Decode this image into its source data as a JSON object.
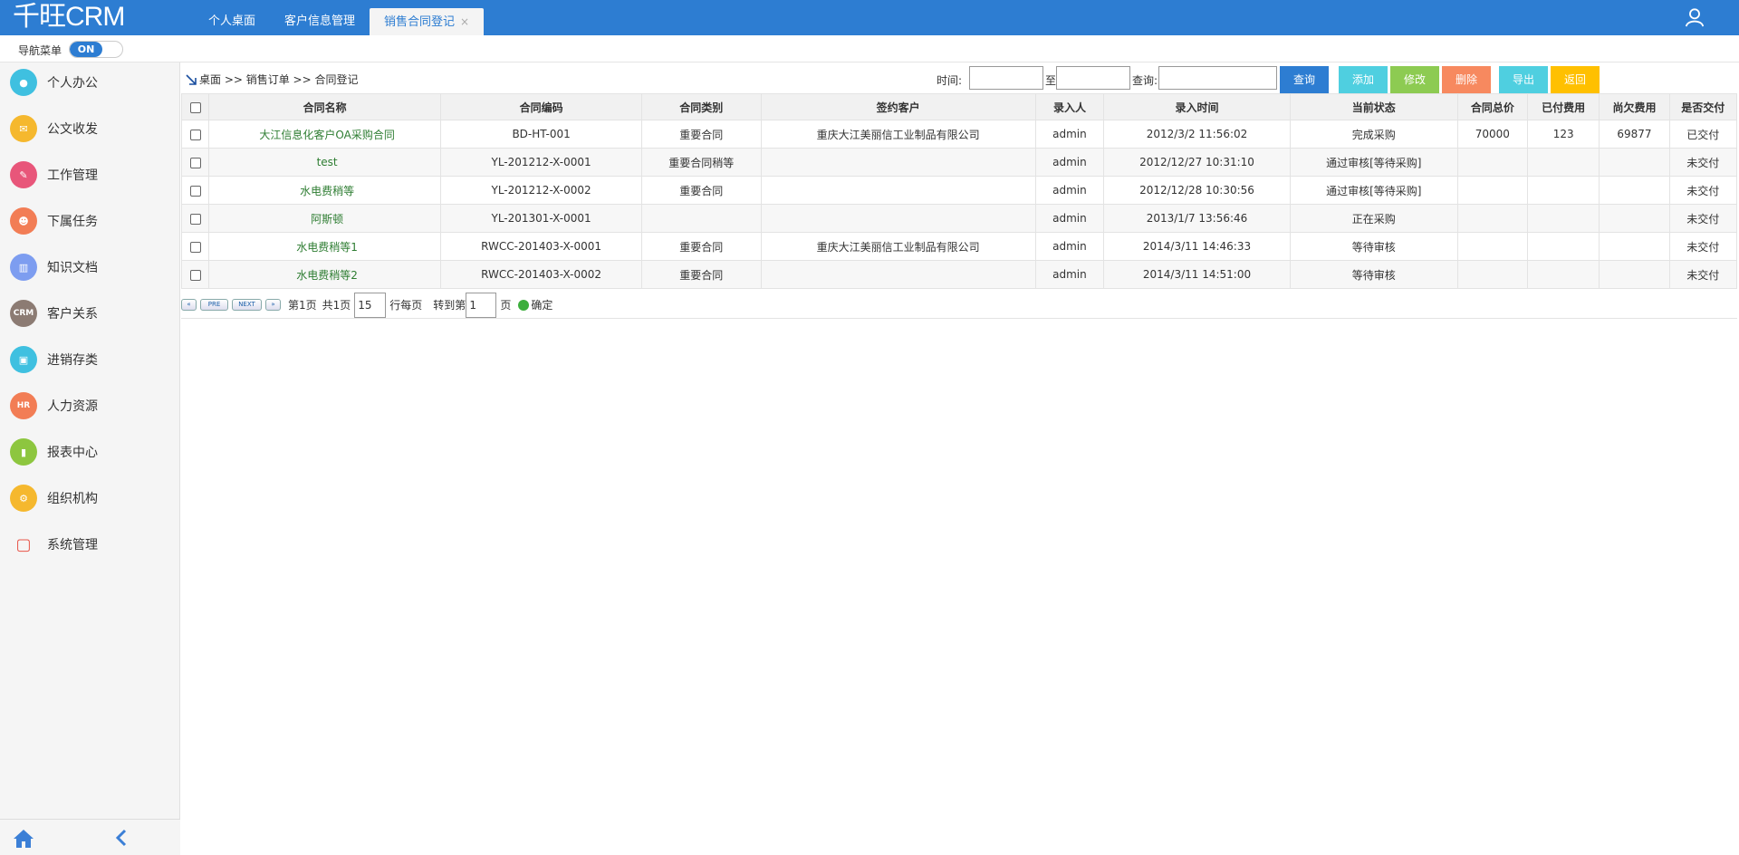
{
  "app": {
    "logo": "千旺CRM"
  },
  "tabs": [
    {
      "label": "个人桌面"
    },
    {
      "label": "客户信息管理"
    },
    {
      "label": "销售合同登记",
      "close": "×"
    }
  ],
  "nav": {
    "label": "导航菜单",
    "toggle": "ON"
  },
  "sidebar": {
    "items": [
      {
        "label": "个人办公",
        "icon": "person-icon",
        "color": "#3fc0e0",
        "glyph": "●"
      },
      {
        "label": "公文收发",
        "icon": "document-icon",
        "color": "#f5b82e",
        "glyph": "✉"
      },
      {
        "label": "工作管理",
        "icon": "work-icon",
        "color": "#e8567a",
        "glyph": "✎"
      },
      {
        "label": "下属任务",
        "icon": "team-icon",
        "color": "#f27d55",
        "glyph": "☻"
      },
      {
        "label": "知识文档",
        "icon": "book-icon",
        "color": "#7d9df0",
        "glyph": "▥"
      },
      {
        "label": "客户关系",
        "icon": "crm-icon",
        "color": "#8c7b73",
        "glyph": "CRM"
      },
      {
        "label": "进销存类",
        "icon": "inventory-icon",
        "color": "#3fc0e0",
        "glyph": "▣"
      },
      {
        "label": "人力资源",
        "icon": "hr-icon",
        "color": "#f27d55",
        "glyph": "HR"
      },
      {
        "label": "报表中心",
        "icon": "chart-icon",
        "color": "#8dc63f",
        "glyph": "▮"
      },
      {
        "label": "组织机构",
        "icon": "org-icon",
        "color": "#f5b82e",
        "glyph": "⚙"
      },
      {
        "label": "系统管理",
        "icon": "system-icon",
        "color": "#e8564a",
        "glyph": "▢"
      }
    ]
  },
  "breadcrumb": "桌面 >> 销售订单 >> 合同登记",
  "filters": {
    "time_label": "时间:",
    "to_label": "至",
    "query_label": "查询:"
  },
  "buttons": {
    "search": {
      "label": "查询",
      "color": "#2d7dd2"
    },
    "add": {
      "label": "添加",
      "color": "#4fcfe0"
    },
    "edit": {
      "label": "修改",
      "color": "#8dcb52"
    },
    "delete": {
      "label": "删除",
      "color": "#f7895f"
    },
    "export": {
      "label": "导出",
      "color": "#4fcfe0"
    },
    "back": {
      "label": "返回",
      "color": "#ffc000"
    }
  },
  "table": {
    "columns": [
      "合同名称",
      "合同编码",
      "合同类别",
      "签约客户",
      "录入人",
      "录入时间",
      "当前状态",
      "合同总价",
      "已付费用",
      "尚欠费用",
      "是否交付"
    ],
    "rows": [
      [
        "大江信息化客户OA采购合同",
        "BD-HT-001",
        "重要合同",
        "重庆大江美丽信工业制品有限公司",
        "admin",
        "2012/3/2 11:56:02",
        "完成采购",
        "70000",
        "123",
        "69877",
        "已交付"
      ],
      [
        "test",
        "YL-201212-X-0001",
        "重要合同稍等",
        "",
        "admin",
        "2012/12/27 10:31:10",
        "通过审核[等待采购]",
        "",
        "",
        "",
        "未交付"
      ],
      [
        "水电费稍等",
        "YL-201212-X-0002",
        "重要合同",
        "",
        "admin",
        "2012/12/28 10:30:56",
        "通过审核[等待采购]",
        "",
        "",
        "",
        "未交付"
      ],
      [
        "阿斯顿",
        "YL-201301-X-0001",
        "",
        "",
        "admin",
        "2013/1/7 13:56:46",
        "正在采购",
        "",
        "",
        "",
        "未交付"
      ],
      [
        "水电费稍等1",
        "RWCC-201403-X-0001",
        "重要合同",
        "重庆大江美丽信工业制品有限公司",
        "admin",
        "2014/3/11 14:46:33",
        "等待审核",
        "",
        "",
        "",
        "未交付"
      ],
      [
        "水电费稍等2",
        "RWCC-201403-X-0002",
        "重要合同",
        "",
        "admin",
        "2014/3/11 14:51:00",
        "等待审核",
        "",
        "",
        "",
        "未交付"
      ]
    ]
  },
  "pager": {
    "first": "«",
    "prev": "PRE",
    "next": "NEXT",
    "last": "»",
    "page_label": "第1页",
    "total_label": "共1页",
    "per_page": "15",
    "per_page_label": "行每页",
    "goto_label": "转到第",
    "goto_value": "1",
    "page_suffix": "页",
    "confirm": "确定"
  }
}
